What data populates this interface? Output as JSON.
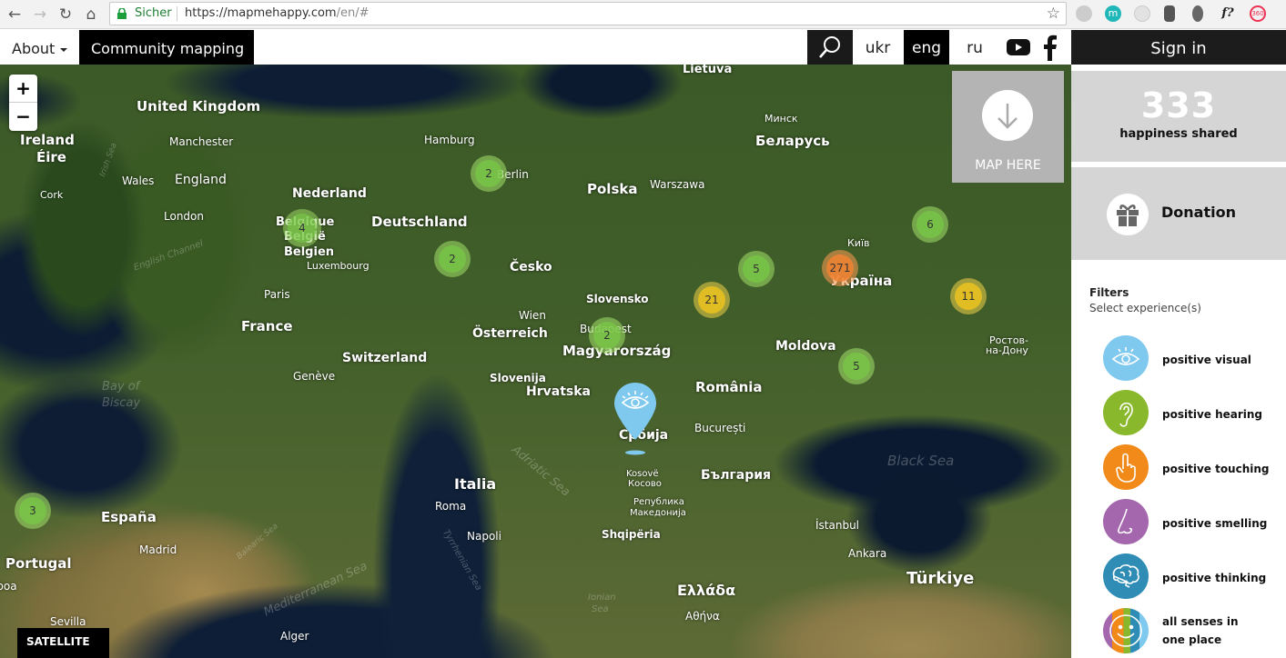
{
  "browser": {
    "secure_label": "Sicher",
    "url_main": "https://mapmehappy.com",
    "url_path": "/en/#",
    "extensions": [
      "camera-icon",
      "m-icon",
      "circle-icon",
      "evernote-icon",
      "lightbulb-icon",
      "f-question-icon",
      "360-icon"
    ],
    "ext_m_label": "m",
    "ext_f_label": "f?",
    "ext_360_label": "360"
  },
  "nav": {
    "about": "About",
    "community": "Community mapping",
    "languages": [
      {
        "label": "ukr",
        "active": false
      },
      {
        "label": "eng",
        "active": true
      },
      {
        "label": "ru",
        "active": false
      }
    ]
  },
  "sidebar": {
    "signin": "Sign in",
    "stats_count": "333",
    "stats_label": "happiness shared",
    "donation": "Donation",
    "filters_title": "Filters",
    "filters_sub": "Select experience(s)",
    "filters": [
      {
        "label": "positive visual",
        "color": "#7fc8ee",
        "icon": "eye-icon"
      },
      {
        "label": "positive hearing",
        "color": "#8ab82c",
        "icon": "ear-icon"
      },
      {
        "label": "positive touching",
        "color": "#f28a1a",
        "icon": "finger-icon"
      },
      {
        "label": "positive smelling",
        "color": "#a466ad",
        "icon": "nose-icon"
      },
      {
        "label": "positive thinking",
        "color": "#2e8cb5",
        "icon": "brain-icon"
      },
      {
        "label_line1": "all senses in",
        "label_line2": "one place",
        "color": "multi",
        "icon": "smiley-icon"
      }
    ]
  },
  "map": {
    "zoom_in": "+",
    "zoom_out": "−",
    "map_here": "MAP HERE",
    "layer": "SATELLITE",
    "clusters": [
      {
        "count": "4",
        "level": "green"
      },
      {
        "count": "2",
        "level": "green"
      },
      {
        "count": "2",
        "level": "green"
      },
      {
        "count": "2",
        "level": "green"
      },
      {
        "count": "5",
        "level": "green"
      },
      {
        "count": "21",
        "level": "yellow"
      },
      {
        "count": "271",
        "level": "orange"
      },
      {
        "count": "6",
        "level": "green"
      },
      {
        "count": "11",
        "level": "yellow"
      },
      {
        "count": "5",
        "level": "green"
      },
      {
        "count": "3",
        "level": "green"
      }
    ],
    "countries": [
      "United Kingdom",
      "Ireland",
      "Éire",
      "Nederland",
      "Belgique",
      "België",
      "Belgien",
      "Deutschland",
      "Polska",
      "Беларусь",
      "Lietuva",
      "Česko",
      "France",
      "Switzerland",
      "Österreich",
      "Magyarország",
      "Slovensko",
      "Slovenija",
      "Hrvatska",
      "România",
      "Србија",
      "България",
      "Україна",
      "Moldova",
      "Italia",
      "España",
      "Portugal",
      "Ελλάδα",
      "Türkiye",
      "Shqipëria",
      "Kosovë",
      "Косово",
      "Република",
      "Македонија"
    ],
    "cities": [
      "Manchester",
      "Wales",
      "England",
      "London",
      "Cork",
      "Hamburg",
      "Berlin",
      "Warszawa",
      "Минск",
      "Київ",
      "Luxembourg",
      "Paris",
      "Wien",
      "Budapest",
      "Genève",
      "București",
      "Roma",
      "Napoli",
      "Madrid",
      "Sevilla",
      "Alger",
      "İstanbul",
      "Ankara",
      "Αθήνα",
      "Ростов-",
      "на-Дону",
      "Lisboa"
    ],
    "seas": [
      "Black Sea",
      "Adriatic Sea",
      "Bay of",
      "Biscay",
      "Mediterranean Sea",
      "English Channel",
      "Tyrrhenian Sea",
      "Ionian",
      "Sea",
      "Balearic Sea",
      "Irish Sea"
    ]
  }
}
